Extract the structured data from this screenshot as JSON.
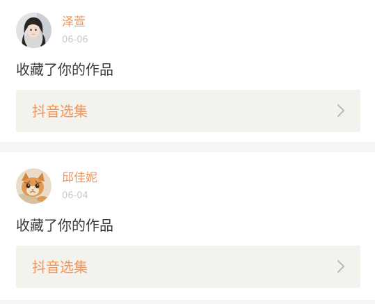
{
  "notifications": [
    {
      "user_name": "泽萱",
      "date": "06-06",
      "action_text": "收藏了你的作品",
      "collection_label": "抖音选集",
      "avatar": "girl-photo-avatar"
    },
    {
      "user_name": "邱佳妮",
      "date": "06-04",
      "action_text": "收藏了你的作品",
      "collection_label": "抖音选集",
      "avatar": "kitten-photo-avatar"
    }
  ],
  "colors": {
    "accent": "#f2955a",
    "date_gray": "#c8c8c8",
    "text_dark": "#3a3a3a",
    "collection_bg": "#f3f2ed",
    "separator": "#f5f5f5"
  },
  "icons": {
    "chevron": "chevron-right-icon"
  }
}
